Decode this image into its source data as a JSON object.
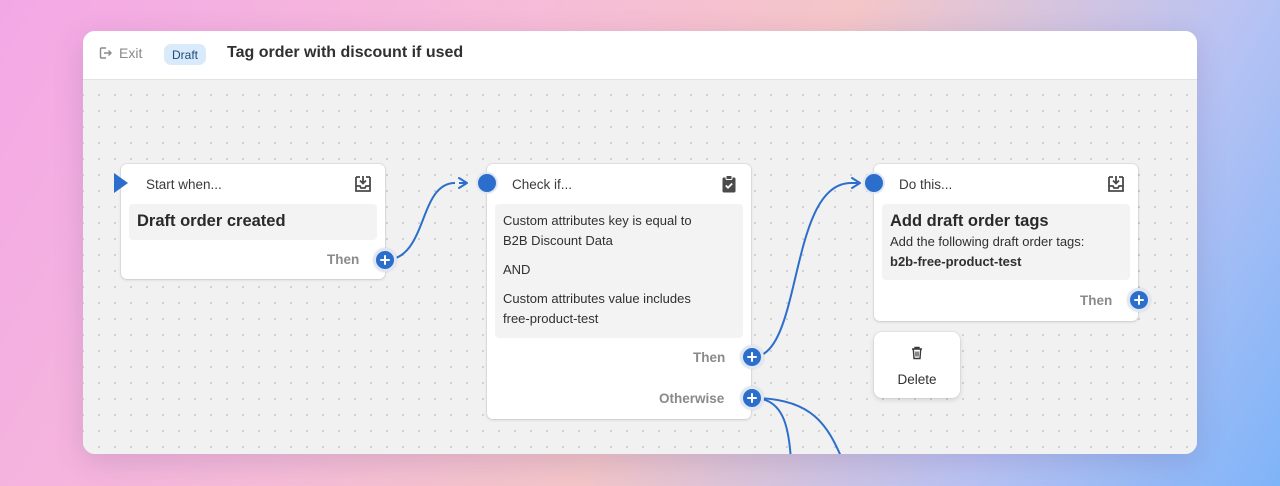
{
  "header": {
    "exit_label": "Exit",
    "status_badge": "Draft",
    "title": "Tag order with discount if used"
  },
  "nodes": {
    "trigger": {
      "header_label": "Start when...",
      "title": "Draft order created",
      "then_label": "Then",
      "icon": "download-tray-icon"
    },
    "condition": {
      "header_label": "Check if...",
      "line1": "Custom attributes key is equal to",
      "line2": "B2B Discount Data",
      "operator": "AND",
      "line3": "Custom attributes value includes",
      "line4": "free-product-test",
      "then_label": "Then",
      "otherwise_label": "Otherwise",
      "icon": "clipboard-check-icon"
    },
    "action": {
      "header_label": "Do this...",
      "title": "Add draft order tags",
      "description": "Add the following draft order tags:",
      "tag_value": "b2b-free-product-test",
      "then_label": "Then",
      "icon": "download-tray-icon"
    }
  },
  "popover": {
    "delete_label": "Delete",
    "icon": "trash-icon"
  },
  "colors": {
    "accent": "#2c6ecb",
    "badge_bg": "#d9ebfb"
  }
}
